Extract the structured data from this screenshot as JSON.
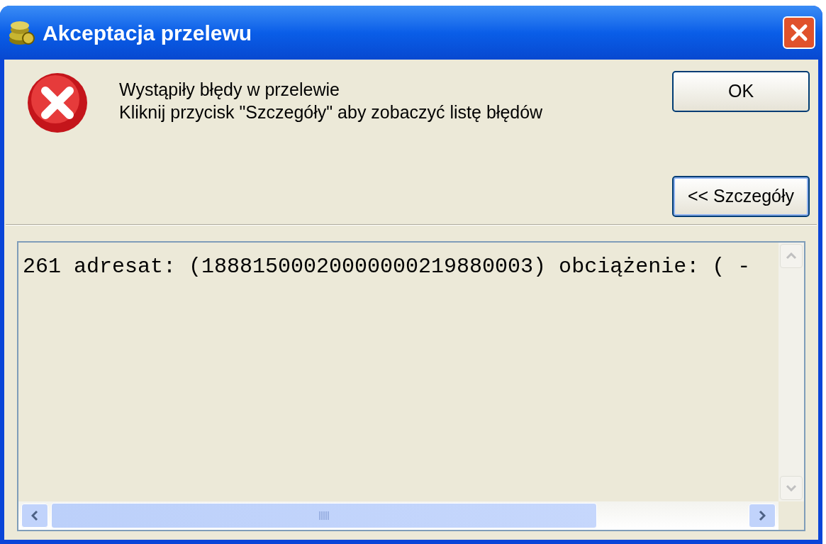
{
  "window": {
    "title": "Akceptacja przelewu"
  },
  "message": {
    "lines": [
      "Wystąpiły błędy w przelewie",
      "Kliknij przycisk \"Szczegóły\" aby zobaczyć listę błędów"
    ]
  },
  "buttons": {
    "ok": "OK",
    "details": "<< Szczegóły"
  },
  "details": {
    "lines": [
      "261 adresat: (18881500020000000219880003) obciążenie: ( -"
    ]
  }
}
